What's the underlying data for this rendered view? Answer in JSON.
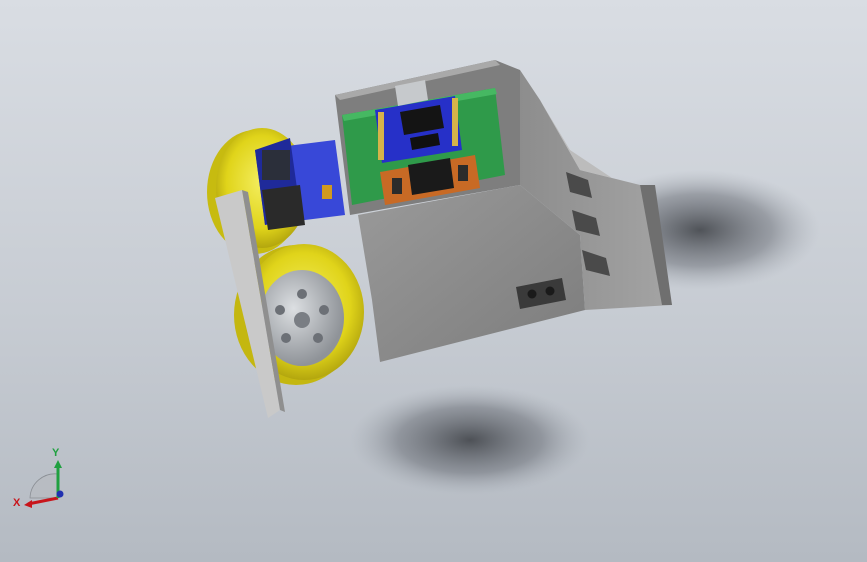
{
  "viewport": {
    "background_top": "#d9dde3",
    "background_bottom": "#b4bac2"
  },
  "model": {
    "body_color": "#8f8f8f",
    "wheel_color": "#e8de1e",
    "hub_color": "#b9bcc0",
    "pcb_color": "#2f9a4a",
    "module_color": "#2630c8",
    "sensor_board_color": "#c86a25",
    "motor_color": "#3848d8"
  },
  "triad": {
    "x_label": "X",
    "y_label": "Y",
    "x_color": "#c8151b",
    "y_color": "#20a040",
    "z_color": "#2030b0"
  }
}
